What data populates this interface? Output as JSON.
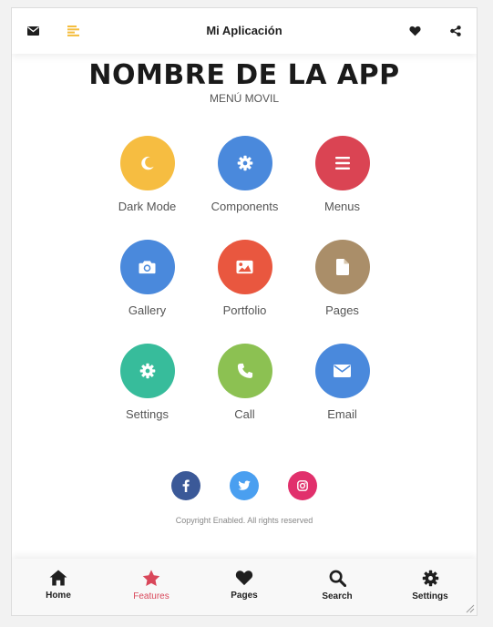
{
  "header": {
    "title": "Mi Aplicación",
    "left_icons": [
      "envelope-icon",
      "menu-lines-icon"
    ],
    "right_icons": [
      "heart-icon",
      "share-icon"
    ],
    "menu_icon_color": "#f4bd3d"
  },
  "hero": {
    "title": "NOMBRE DE LA APP",
    "subtitle": "MENÚ MOVIL"
  },
  "grid": [
    {
      "label": "Dark Mode",
      "icon": "moon-icon",
      "color": "#f6bd41"
    },
    {
      "label": "Components",
      "icon": "gear-icon",
      "color": "#4a89dc"
    },
    {
      "label": "Menus",
      "icon": "bars-icon",
      "color": "#da4453"
    },
    {
      "label": "Gallery",
      "icon": "camera-icon",
      "color": "#4a89dc"
    },
    {
      "label": "Portfolio",
      "icon": "image-icon",
      "color": "#e9573f"
    },
    {
      "label": "Pages",
      "icon": "file-icon",
      "color": "#aa8e69"
    },
    {
      "label": "Settings",
      "icon": "gear-icon",
      "color": "#37bc9b"
    },
    {
      "label": "Call",
      "icon": "phone-icon",
      "color": "#8cc152"
    },
    {
      "label": "Email",
      "icon": "envelope-icon",
      "color": "#4a89dc"
    }
  ],
  "social": [
    {
      "name": "facebook-icon",
      "color": "#3b5998"
    },
    {
      "name": "twitter-icon",
      "color": "#4a9ff0"
    },
    {
      "name": "instagram-icon",
      "color": "#e1306c"
    }
  ],
  "footer": {
    "copyright": "Copyright Enabled. All rights reserved"
  },
  "bottom_nav": [
    {
      "label": "Home",
      "icon": "home-icon",
      "active": false
    },
    {
      "label": "Features",
      "icon": "star-icon",
      "active": true
    },
    {
      "label": "Pages",
      "icon": "heart-icon",
      "active": false
    },
    {
      "label": "Search",
      "icon": "search-icon",
      "active": false
    },
    {
      "label": "Settings",
      "icon": "gear-icon",
      "active": false
    }
  ],
  "accent_active": "#d9475a"
}
